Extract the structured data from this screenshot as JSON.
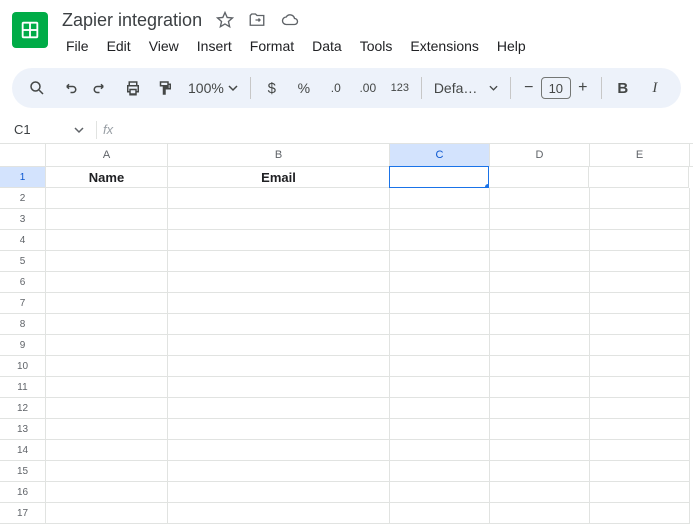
{
  "doc": {
    "title": "Zapier integration"
  },
  "menu": {
    "file": "File",
    "edit": "Edit",
    "view": "View",
    "insert": "Insert",
    "format": "Format",
    "data": "Data",
    "tools": "Tools",
    "extensions": "Extensions",
    "help": "Help"
  },
  "toolbar": {
    "zoom": "100%",
    "font": "Defaul…",
    "font_size": "10"
  },
  "formula": {
    "name_box": "C1",
    "fx": "fx",
    "value": ""
  },
  "columns": {
    "A": "A",
    "B": "B",
    "C": "C",
    "D": "D",
    "E": "E"
  },
  "cells": {
    "A1": "Name",
    "B1": "Email"
  },
  "selected": {
    "col": "C",
    "row": 1
  }
}
